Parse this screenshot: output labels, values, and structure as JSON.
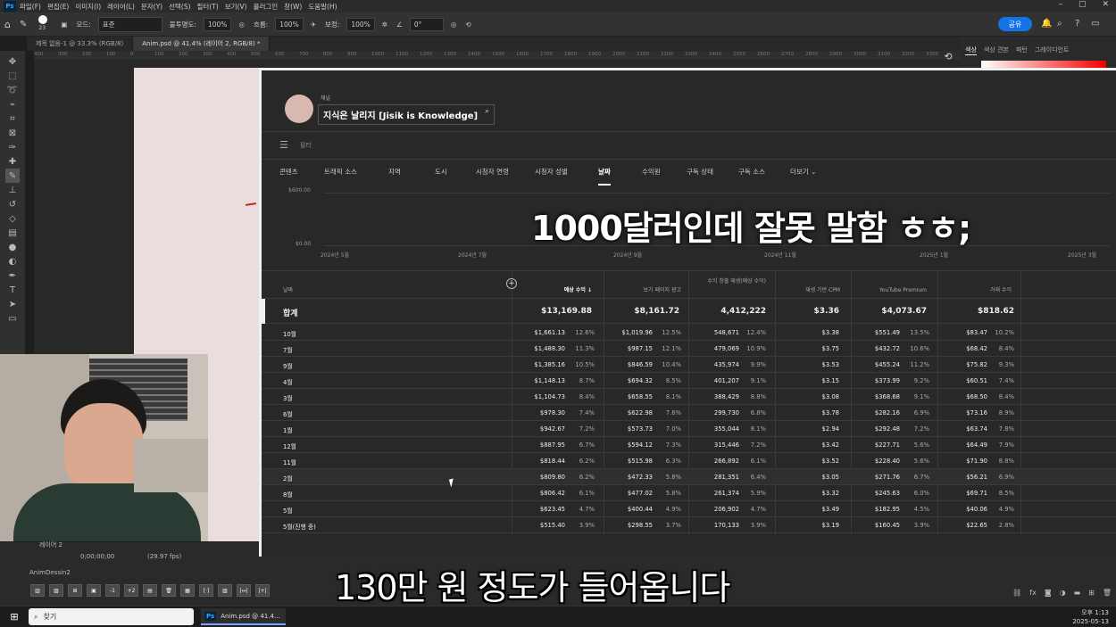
{
  "menubar": {
    "app_icon": "Ps",
    "items": [
      "파일(F)",
      "편집(E)",
      "이미지(I)",
      "레이어(L)",
      "문자(Y)",
      "선택(S)",
      "필터(T)",
      "보기(V)",
      "플러그인",
      "창(W)",
      "도움말(H)"
    ],
    "window_controls": [
      "–",
      "▢",
      "✕"
    ]
  },
  "options": {
    "mode_label": "모드:",
    "mode_value": "표준",
    "opacity_label": "불투명도:",
    "opacity_value": "100%",
    "flow_label": "흐름:",
    "flow_value": "100%",
    "smooth_label": "보정:",
    "smooth_value": "100%",
    "angle_value": "0°",
    "brush_size": "23",
    "share_label": "공유"
  },
  "doc_tabs": [
    "제목 없음-1 @ 33.3% (RGB/8)",
    "Anim.psd @ 41.4% (레이어 2, RGB/8) *"
  ],
  "ruler_ticks": [
    "400",
    "300",
    "200",
    "100",
    "0",
    "100",
    "200",
    "300",
    "400",
    "500",
    "600",
    "700",
    "800",
    "900",
    "1000",
    "1100",
    "1200",
    "1300",
    "1400",
    "1500",
    "1600",
    "1700",
    "1800",
    "1900",
    "2000",
    "2100",
    "2200",
    "2300",
    "2400",
    "2500",
    "2600",
    "2700",
    "2800",
    "2900",
    "3000",
    "3100",
    "3200",
    "3300"
  ],
  "right_panel": {
    "tabs": [
      "색상",
      "색상 견본",
      "패턴",
      "그레이디언트"
    ]
  },
  "timeline": {
    "layer_label": "레이어 2",
    "timecode": "0;00;00;00",
    "fps": "(29.97 fps)",
    "panel_title": "AnimDessin2"
  },
  "youtube": {
    "channel_label": "채널",
    "channel_name": "지식은 날리지 [Jisik is Knowledge]",
    "filter_label": "필터",
    "tabs": [
      "콘텐츠",
      "트래픽 소스",
      "지역",
      "도시",
      "시청자 연령",
      "시청자 성별",
      "날짜",
      "수익원",
      "구독 상태",
      "구독 소스",
      "더보기"
    ],
    "active_tab": "날짜",
    "chart_y_ticks": [
      "$600.00",
      "$0.00"
    ],
    "chart_x_ticks": [
      "2024년 5월",
      "2024년 7월",
      "2024년 9월",
      "2024년 11월",
      "2025년 1월",
      "2025년 3월"
    ],
    "overlay_caption": "1000달러인데 잘못 말함 ㅎㅎ;",
    "columns": [
      "날짜",
      "예상 수익 ↓",
      "보기 페이지 광고",
      "수익 창출 재생(예상 수익)",
      "재생 기반 CPM",
      "YouTube Premium",
      "거래 수익"
    ],
    "total": {
      "label": "합계",
      "rev": "$13,169.88",
      "ads": "$8,161.72",
      "plays": "4,412,222",
      "cpm": "$3.36",
      "premium": "$4,073.67",
      "trans": "$818.62"
    },
    "rows": [
      {
        "label": "10월",
        "rev": "$1,661.13",
        "rev_p": "12.6%",
        "ads": "$1,019.96",
        "ads_p": "12.5%",
        "plays": "548,671",
        "plays_p": "12.4%",
        "cpm": "$3.38",
        "prem": "$551.49",
        "prem_p": "13.5%",
        "trans": "$83.47",
        "trans_p": "10.2%"
      },
      {
        "label": "7월",
        "rev": "$1,488.30",
        "rev_p": "11.3%",
        "ads": "$987.15",
        "ads_p": "12.1%",
        "plays": "479,069",
        "plays_p": "10.9%",
        "cpm": "$3.75",
        "prem": "$432.72",
        "prem_p": "10.6%",
        "trans": "$68.42",
        "trans_p": "8.4%"
      },
      {
        "label": "9월",
        "rev": "$1,385.16",
        "rev_p": "10.5%",
        "ads": "$846.59",
        "ads_p": "10.4%",
        "plays": "435,974",
        "plays_p": "9.9%",
        "cpm": "$3.53",
        "prem": "$455.24",
        "prem_p": "11.2%",
        "trans": "$75.82",
        "trans_p": "9.3%"
      },
      {
        "label": "4월",
        "rev": "$1,148.13",
        "rev_p": "8.7%",
        "ads": "$694.32",
        "ads_p": "8.5%",
        "plays": "401,207",
        "plays_p": "9.1%",
        "cpm": "$3.15",
        "prem": "$373.99",
        "prem_p": "9.2%",
        "trans": "$60.51",
        "trans_p": "7.4%"
      },
      {
        "label": "3월",
        "rev": "$1,104.73",
        "rev_p": "8.4%",
        "ads": "$658.55",
        "ads_p": "8.1%",
        "plays": "388,429",
        "plays_p": "8.8%",
        "cpm": "$3.08",
        "prem": "$368.68",
        "prem_p": "9.1%",
        "trans": "$68.50",
        "trans_p": "8.4%"
      },
      {
        "label": "6월",
        "rev": "$978.30",
        "rev_p": "7.4%",
        "ads": "$622.98",
        "ads_p": "7.6%",
        "plays": "299,730",
        "plays_p": "6.8%",
        "cpm": "$3.78",
        "prem": "$282.16",
        "prem_p": "6.9%",
        "trans": "$73.16",
        "trans_p": "8.9%"
      },
      {
        "label": "1월",
        "rev": "$942.67",
        "rev_p": "7.2%",
        "ads": "$573.73",
        "ads_p": "7.0%",
        "plays": "355,044",
        "plays_p": "8.1%",
        "cpm": "$2.94",
        "prem": "$292.48",
        "prem_p": "7.2%",
        "trans": "$63.74",
        "trans_p": "7.8%"
      },
      {
        "label": "12월",
        "rev": "$887.95",
        "rev_p": "6.7%",
        "ads": "$594.12",
        "ads_p": "7.3%",
        "plays": "315,446",
        "plays_p": "7.2%",
        "cpm": "$3.42",
        "prem": "$227.71",
        "prem_p": "5.6%",
        "trans": "$64.49",
        "trans_p": "7.9%"
      },
      {
        "label": "11월",
        "rev": "$818.44",
        "rev_p": "6.2%",
        "ads": "$515.98",
        "ads_p": "6.3%",
        "plays": "266,892",
        "plays_p": "6.1%",
        "cpm": "$3.52",
        "prem": "$228.40",
        "prem_p": "5.6%",
        "trans": "$71.90",
        "trans_p": "8.8%"
      },
      {
        "label": "2월",
        "rev": "$809.80",
        "rev_p": "6.2%",
        "ads": "$472.33",
        "ads_p": "5.8%",
        "plays": "281,351",
        "plays_p": "6.4%",
        "cpm": "$3.05",
        "prem": "$271.76",
        "prem_p": "6.7%",
        "trans": "$56.21",
        "trans_p": "6.9%"
      },
      {
        "label": "8월",
        "rev": "$806.42",
        "rev_p": "6.1%",
        "ads": "$477.02",
        "ads_p": "5.8%",
        "plays": "261,374",
        "plays_p": "5.9%",
        "cpm": "$3.32",
        "prem": "$245.63",
        "prem_p": "6.0%",
        "trans": "$69.71",
        "trans_p": "8.5%"
      },
      {
        "label": "5월",
        "rev": "$623.45",
        "rev_p": "4.7%",
        "ads": "$400.44",
        "ads_p": "4.9%",
        "plays": "206,902",
        "plays_p": "4.7%",
        "cpm": "$3.49",
        "prem": "$182.95",
        "prem_p": "4.5%",
        "trans": "$40.06",
        "trans_p": "4.9%"
      },
      {
        "label": "5월(진행 중)",
        "rev": "$515.40",
        "rev_p": "3.9%",
        "ads": "$298.55",
        "ads_p": "3.7%",
        "plays": "170,133",
        "plays_p": "3.9%",
        "cpm": "$3.19",
        "prem": "$160.45",
        "prem_p": "3.9%",
        "trans": "$22.65",
        "trans_p": "2.8%"
      }
    ]
  },
  "subtitle": "130만 원 정도가 들어옵니다",
  "taskbar": {
    "search_label": "찾기",
    "ps_task": "Anim.psd @ 41.4...",
    "time": "오후 1:13",
    "date": "2025-05-13"
  }
}
